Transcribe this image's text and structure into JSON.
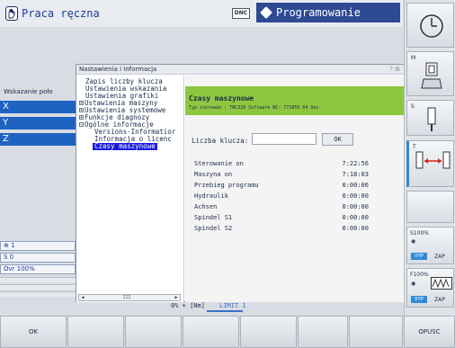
{
  "header": {
    "mode_left": "Praca ręczna",
    "dnc": "DNC",
    "mode_right": "Programowanie"
  },
  "status": {
    "title": "Wskazanie poło",
    "axes": [
      "X",
      "Y",
      "Z"
    ],
    "tool": "1",
    "spindle": "S 0",
    "override": "Ovr 100%"
  },
  "dialog": {
    "title": "Nastawienia i informacja",
    "window_controls": "? ⊠",
    "tree": [
      {
        "label": "Zapis liczby klucza",
        "level": 1,
        "expander": ""
      },
      {
        "label": "Ustawienia wskazania",
        "level": 1,
        "expander": ""
      },
      {
        "label": "Ustawienia grafiki",
        "level": 1,
        "expander": ""
      },
      {
        "label": "Ustawienia maszyny",
        "level": 0,
        "expander": "+"
      },
      {
        "label": "Ustawienia systemowe",
        "level": 0,
        "expander": "+"
      },
      {
        "label": "Funkcje diagnozy",
        "level": 0,
        "expander": "+"
      },
      {
        "label": "Ogólne informacje",
        "level": 0,
        "expander": "−"
      },
      {
        "label": "Versions-Informatior",
        "level": 2,
        "expander": ""
      },
      {
        "label": "Informacja o licenc",
        "level": 2,
        "expander": ""
      },
      {
        "label": "Czasy maszynowe",
        "level": 2,
        "expander": "",
        "selected": true
      }
    ],
    "tree_scroll_mid": "III",
    "panel_title": "Czasy maszynowe",
    "panel_subtitle": "Typ sterowan : TNC320     Software NC: 771855 04 Dev",
    "key_label": "Liczba klucza:",
    "key_value": "",
    "ok_small": "OK",
    "times": [
      {
        "label": "Sterowanie on",
        "value": "7:22:56"
      },
      {
        "label": "Maszyna on",
        "value": "7:18:03"
      },
      {
        "label": "Przebieg programu",
        "value": "0:00:06"
      },
      {
        "label": "Hydraulik",
        "value": "0:00:00"
      },
      {
        "label": "Achsen",
        "value": "0:00:00"
      },
      {
        "label": "Spindel S1",
        "value": "0:00:00"
      },
      {
        "label": "Spindel S2",
        "value": "0:00:00"
      }
    ]
  },
  "cut_row": {
    "a": "0% + [Nm]",
    "b": "LIMIT 1"
  },
  "softkeys": [
    "OK",
    "",
    "",
    "",
    "",
    "",
    "",
    "OPUSC"
  ],
  "sidebar": {
    "m": "M",
    "s": "S",
    "t": "T",
    "s_override": "S100%",
    "s_vyp": "VYP",
    "s_zap": "ZAP",
    "f_override": "F100%",
    "f_vyp": "VYP",
    "f_zap": "ZAP"
  },
  "colors": {
    "axis": "#1e63c2",
    "green_header": "#8dc63f",
    "selected": "#1a1ae0",
    "mode_right": "#2d4a93"
  }
}
